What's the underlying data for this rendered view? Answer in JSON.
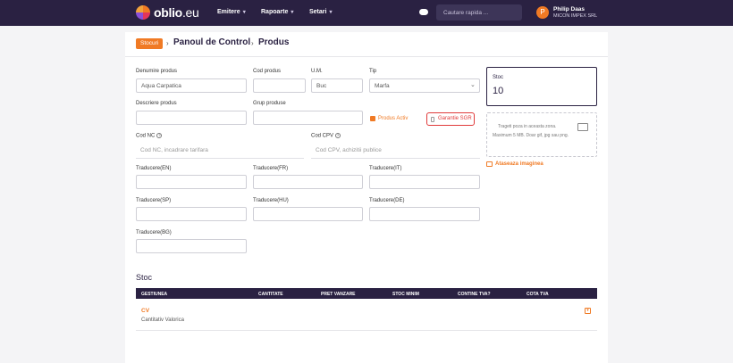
{
  "app": {
    "logo": "oblio",
    "logo_suffix": ".eu",
    "nav": [
      {
        "label": "Emitere"
      },
      {
        "label": "Rapoarte"
      },
      {
        "label": "Setari"
      }
    ],
    "search_placeholder": "Cautare rapida ...",
    "user": {
      "initial": "P",
      "name": "Philip Daas",
      "company": "MICON IMPEX SRL"
    }
  },
  "breadcrumb": {
    "tag": "Stocuri",
    "items": [
      "Panoul de Control",
      "Produs"
    ]
  },
  "form": {
    "denumire": {
      "label": "Denumire produs",
      "value": "Aqua Carpatica"
    },
    "cod_produs": {
      "label": "Cod produs",
      "value": ""
    },
    "um": {
      "label": "U.M.",
      "value": "Buc"
    },
    "tip": {
      "label": "Tip",
      "value": "Marfa"
    },
    "descriere": {
      "label": "Descriere produs",
      "value": ""
    },
    "grup": {
      "label": "Grup produse",
      "value": ""
    },
    "produs_activ": {
      "label": "Produs Activ",
      "checked": true
    },
    "garantie": {
      "label": "Garantie SGR",
      "checked": false
    },
    "cod_nc": {
      "label": "Cod NC",
      "placeholder": "Cod NC, incadrare tarifara"
    },
    "cod_cpv": {
      "label": "Cod CPV",
      "placeholder": "Cod CPV, achizitii publice"
    },
    "traduceri": [
      {
        "label": "Traducere(EN)"
      },
      {
        "label": "Traducere(FR)"
      },
      {
        "label": "Traducere(IT)"
      },
      {
        "label": "Traducere(SP)"
      },
      {
        "label": "Traducere(HU)"
      },
      {
        "label": "Traducere(DE)"
      },
      {
        "label": "Traducere(BG)"
      }
    ]
  },
  "stoc_box": {
    "label": "Stoc",
    "value": "10"
  },
  "upload": {
    "line1": "Trageti poza in aceasta zona.",
    "line2": "Maximum 5 MB. Doar gif, jpg sau png.",
    "attach_label": "Ataseaza imaginea"
  },
  "stock_table": {
    "title": "Stoc",
    "columns": [
      "GESTIUNEA",
      "CANTITATE",
      "PRET VANZARE",
      "STOC MINIM",
      "CONTINE TVA?",
      "COTA TVA"
    ],
    "rows": [
      {
        "gestiune": "CV",
        "subtitle": "Cantitativ Valorica"
      }
    ]
  },
  "colors": {
    "accent": "#f07a24",
    "nav_bg": "#2a2142",
    "error": "#e03a3a"
  }
}
